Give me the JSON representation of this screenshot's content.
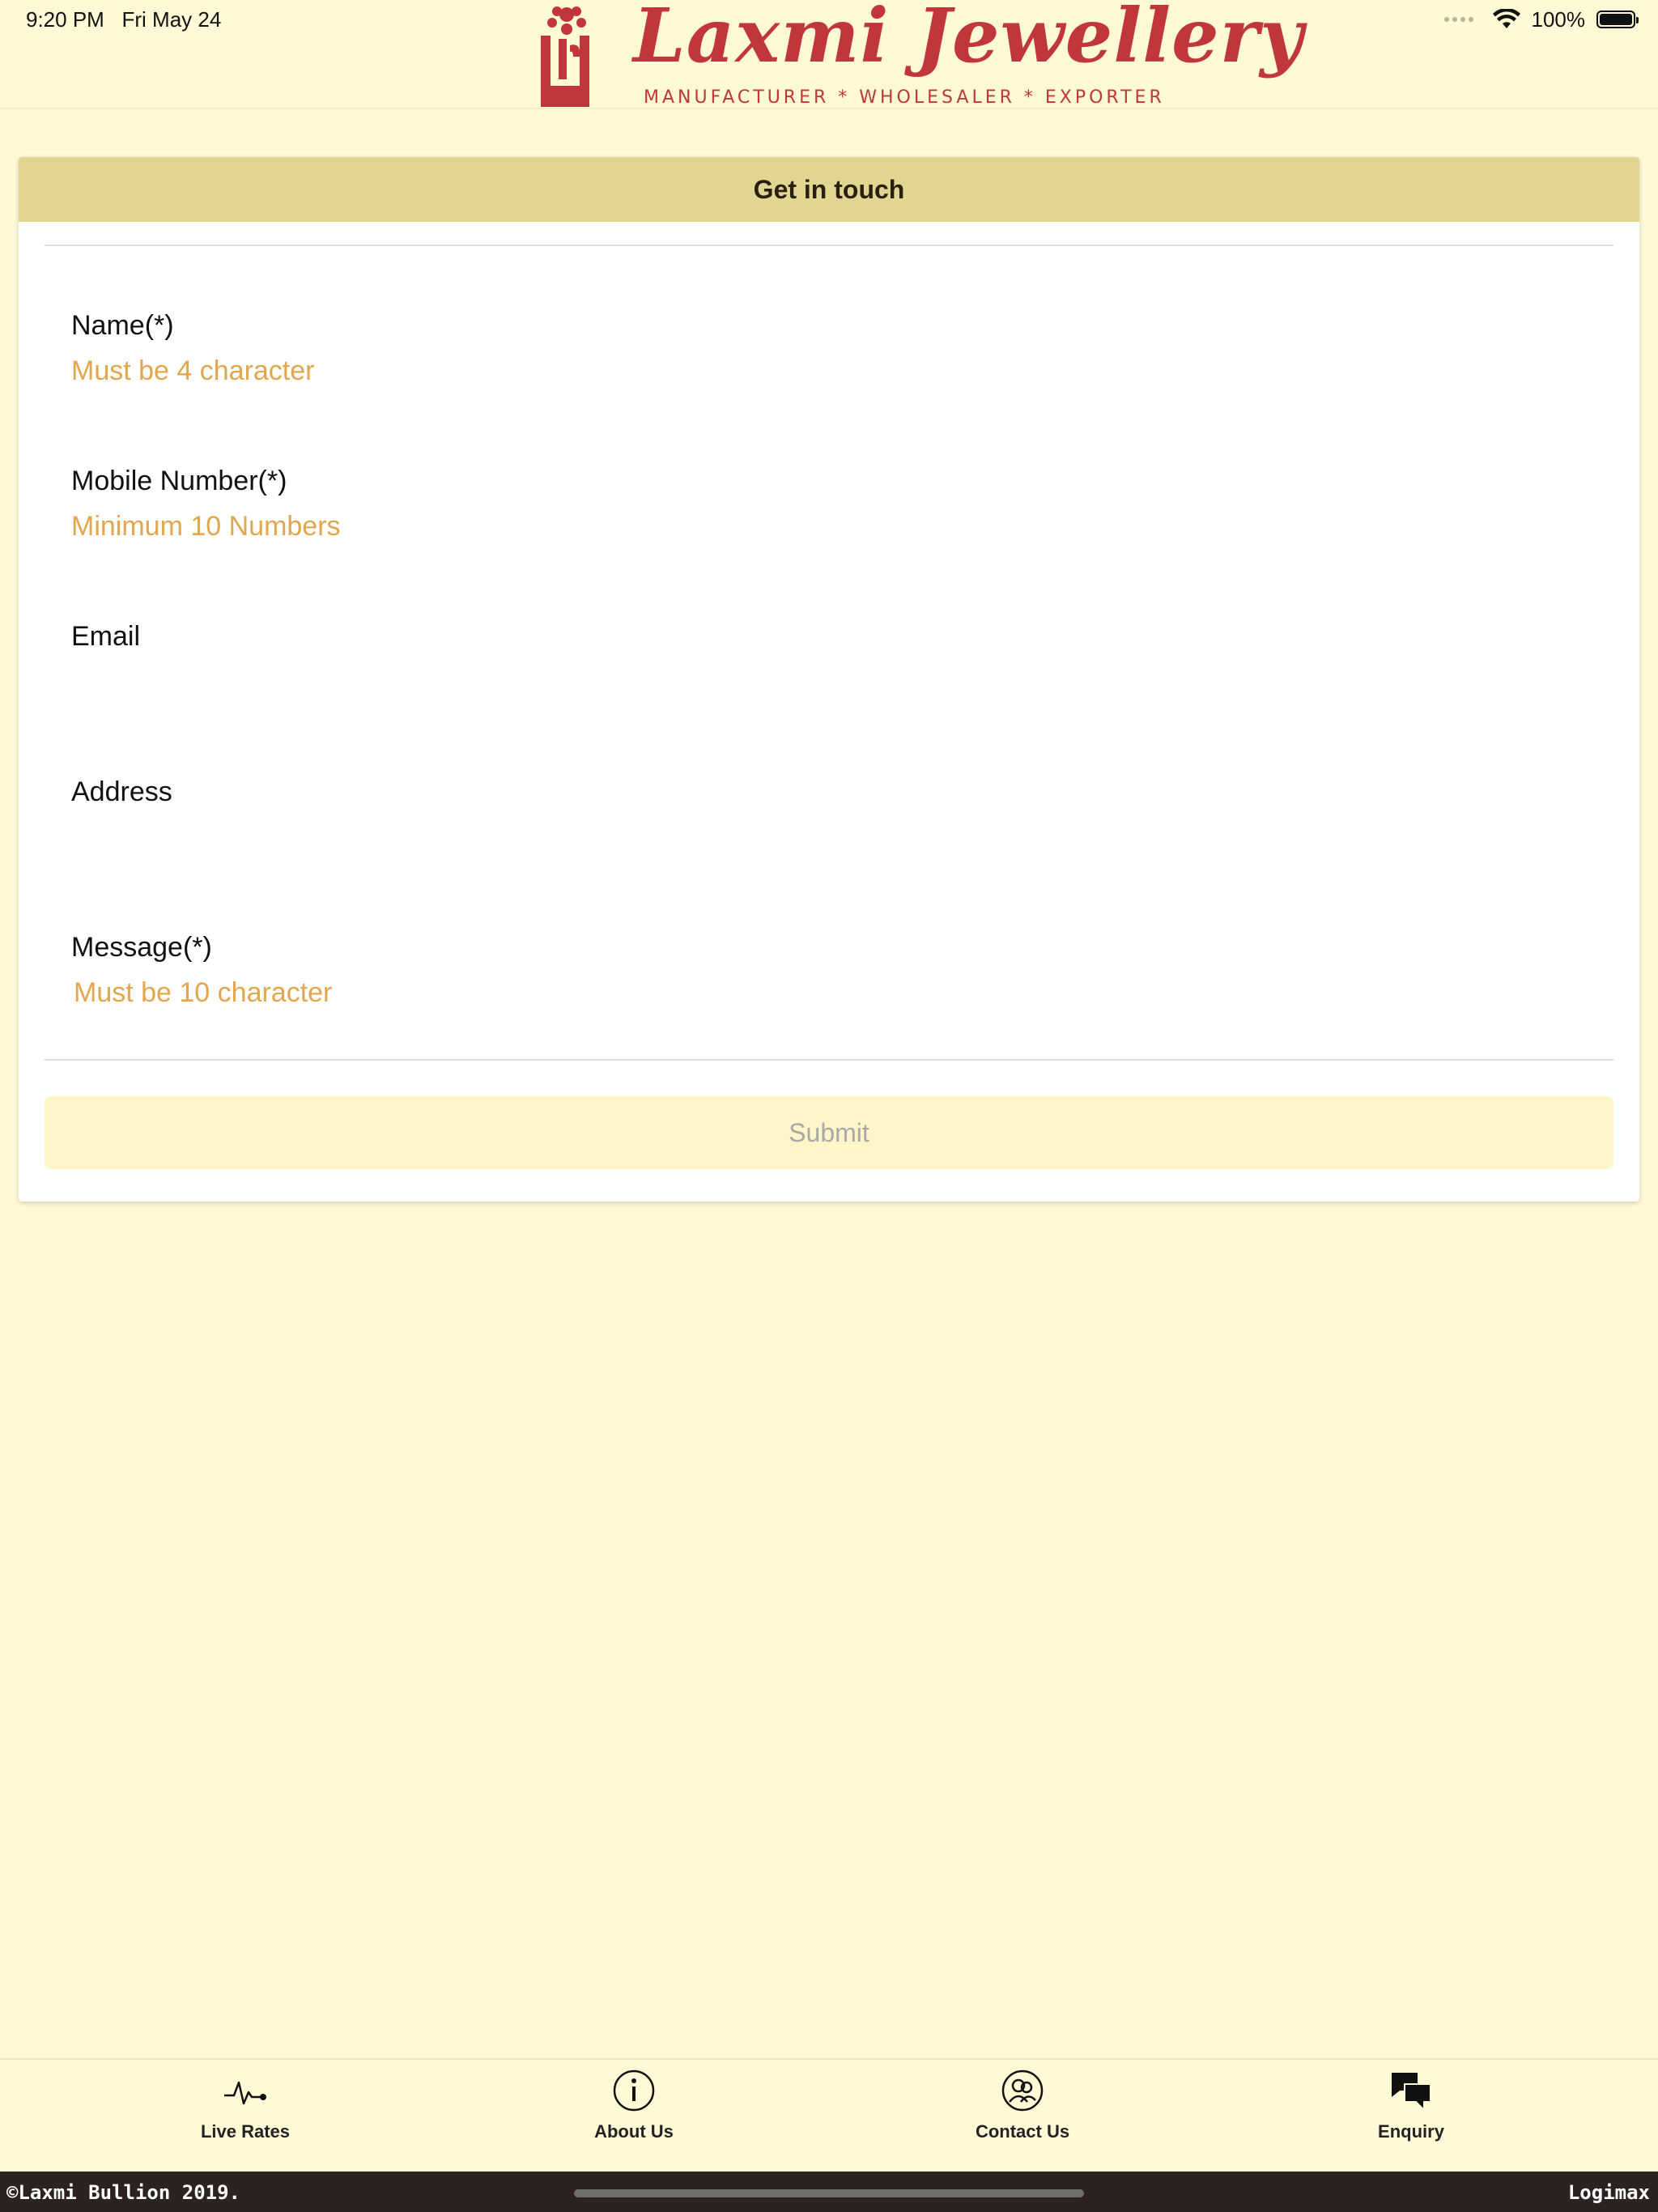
{
  "status_bar": {
    "time": "9:20 PM",
    "date": "Fri May 24",
    "battery": "100%",
    "battery_level": 1.0
  },
  "header": {
    "brand_name": "Laxmi Jewellery",
    "tagline": "MANUFACTURER * WHOLESALER * EXPORTER"
  },
  "form": {
    "title": "Get in touch",
    "fields": [
      {
        "label": "Name(*)",
        "placeholder": "Must be 4 character",
        "value": ""
      },
      {
        "label": "Mobile Number(*)",
        "placeholder": "Minimum 10 Numbers",
        "value": ""
      },
      {
        "label": "Email",
        "placeholder": "",
        "value": ""
      },
      {
        "label": "Address",
        "placeholder": "",
        "value": ""
      },
      {
        "label": "Message(*)",
        "placeholder": "Must be 10 character",
        "value": ""
      }
    ],
    "submit_label": "Submit"
  },
  "tabbar": {
    "tabs": [
      {
        "label": "Live Rates",
        "icon": "pulse-icon"
      },
      {
        "label": "About Us",
        "icon": "info-icon"
      },
      {
        "label": "Contact Us",
        "icon": "contacts-icon"
      },
      {
        "label": "Enquiry",
        "icon": "chat-bubbles-icon"
      }
    ]
  },
  "footer": {
    "copyright": "©Laxmi Bullion 2019.",
    "credit": "Logimax"
  },
  "colors": {
    "background": "#FFF9D6",
    "brand": "#C1363A",
    "card_header": "#E2D592",
    "placeholder": "#E2A64C",
    "submit_bg": "#FFF5C9",
    "footer_bg": "#2B2221"
  }
}
